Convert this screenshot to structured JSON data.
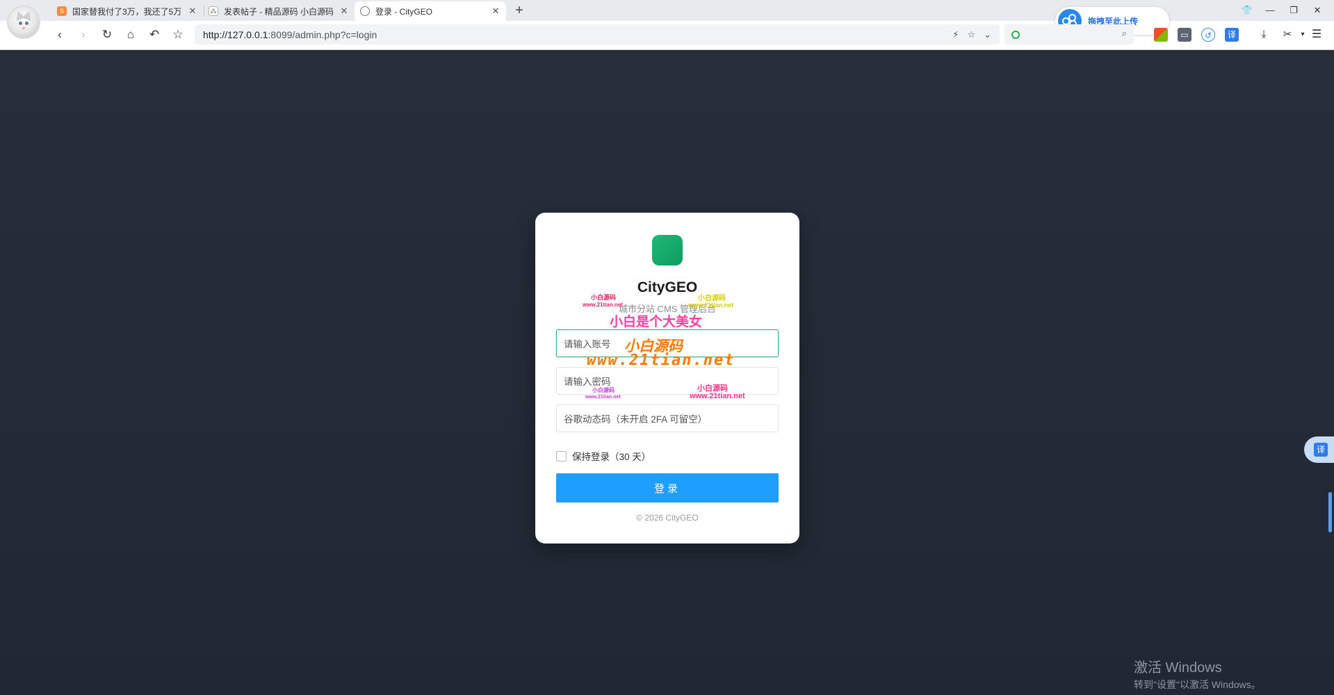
{
  "browser": {
    "tabs": [
      {
        "title": "国家替我付了3万，我还了5万",
        "favicon": "orange-square-icon",
        "color": "#ff8a3d"
      },
      {
        "title": "发表帖子 - 精品源码 小白源码",
        "favicon": "puzzle-icon",
        "color": "#9aa0a6"
      },
      {
        "title": "登录 - CityGEO",
        "favicon": "globe-icon",
        "color": "#8a8a8a"
      }
    ],
    "new_tab": "+",
    "upload_label": "拖拽至此上传",
    "url_host": "http://127.0.0.1",
    "url_rest": ":8099/admin.php?c=login",
    "translate_label": "译"
  },
  "login": {
    "brand": "CityGEO",
    "subtitle": "城市分站 CMS 管理后台",
    "username_placeholder": "请输入账号",
    "password_placeholder": "请输入密码",
    "totp_placeholder": "谷歌动态码（未开启 2FA 可留空）",
    "remember_label": "保持登录（30 天）",
    "submit_label": "登录",
    "copyright": "© 2026 CityGEO",
    "brand_color": "#1fb874",
    "button_color": "#1e9fff"
  },
  "watermarks": {
    "small_cn": "小白源码",
    "small_url": "www.21tian.net",
    "big_cn": "小白是个大美女",
    "orange_cn": "小白源码",
    "orange_url": "www.21tian.net"
  },
  "os": {
    "activation_title": "激活 Windows",
    "activation_hint": "转到\"设置\"以激活 Windows。"
  }
}
